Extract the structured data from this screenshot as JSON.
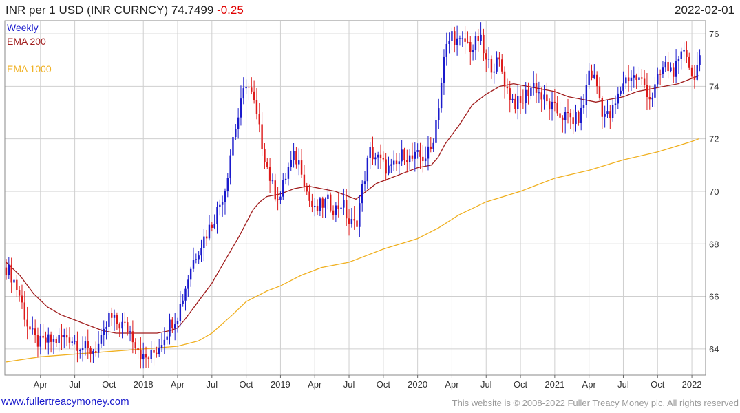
{
  "header": {
    "title": "INR per 1 USD (INR CURNCY)",
    "last": "74.7499",
    "change": "-0.25",
    "date": "2022-02-01"
  },
  "footer": {
    "site": "www.fullertreacymoney.com",
    "copyright": "This website is © 2008-2022 Fuller Treacy Money plc. All rights reserved"
  },
  "colors": {
    "up_candle": "#1a1acc",
    "down_candle": "#dd1a1a",
    "ema200": "#a01c1c",
    "ema1000": "#f0b020",
    "grid": "#cfcfcf",
    "frame": "#8a8a8a"
  },
  "chart_data": {
    "type": "candlestick",
    "period_label": "Weekly",
    "legend": [
      "Weekly",
      "EMA 200",
      "EMA 1000"
    ],
    "ylim": [
      63,
      76.5
    ],
    "y_ticks": [
      64,
      66,
      68,
      70,
      72,
      74,
      76
    ],
    "x_ticks": [
      {
        "t": 2017.25,
        "label": "Apr"
      },
      {
        "t": 2017.5,
        "label": "Jul"
      },
      {
        "t": 2017.75,
        "label": "Oct"
      },
      {
        "t": 2018.0,
        "label": "2018"
      },
      {
        "t": 2018.25,
        "label": "Apr"
      },
      {
        "t": 2018.5,
        "label": "Jul"
      },
      {
        "t": 2018.75,
        "label": "Oct"
      },
      {
        "t": 2019.0,
        "label": "2019"
      },
      {
        "t": 2019.25,
        "label": "Apr"
      },
      {
        "t": 2019.5,
        "label": "Jul"
      },
      {
        "t": 2019.75,
        "label": "Oct"
      },
      {
        "t": 2020.0,
        "label": "2020"
      },
      {
        "t": 2020.25,
        "label": "Apr"
      },
      {
        "t": 2020.5,
        "label": "Jul"
      },
      {
        "t": 2020.75,
        "label": "Oct"
      },
      {
        "t": 2021.0,
        "label": "2021"
      },
      {
        "t": 2021.25,
        "label": "Apr"
      },
      {
        "t": 2021.5,
        "label": "Jul"
      },
      {
        "t": 2021.75,
        "label": "Oct"
      },
      {
        "t": 2022.0,
        "label": "2022"
      }
    ],
    "x_range": [
      2016.99,
      2022.1
    ],
    "closes": [
      [
        2017.0,
        67.1
      ],
      [
        2017.05,
        66.7
      ],
      [
        2017.1,
        66.0
      ],
      [
        2017.15,
        65.0
      ],
      [
        2017.2,
        64.4
      ],
      [
        2017.25,
        64.2
      ],
      [
        2017.3,
        64.3
      ],
      [
        2017.35,
        64.3
      ],
      [
        2017.4,
        64.4
      ],
      [
        2017.45,
        64.5
      ],
      [
        2017.5,
        64.3
      ],
      [
        2017.55,
        64.1
      ],
      [
        2017.6,
        63.9
      ],
      [
        2017.65,
        64.0
      ],
      [
        2017.7,
        64.3
      ],
      [
        2017.75,
        65.2
      ],
      [
        2017.8,
        65.0
      ],
      [
        2017.85,
        64.9
      ],
      [
        2017.9,
        64.7
      ],
      [
        2017.95,
        64.2
      ],
      [
        2018.0,
        63.6
      ],
      [
        2018.05,
        63.7
      ],
      [
        2018.1,
        64.0
      ],
      [
        2018.15,
        64.5
      ],
      [
        2018.2,
        65.0
      ],
      [
        2018.25,
        65.3
      ],
      [
        2018.3,
        66.2
      ],
      [
        2018.35,
        67.2
      ],
      [
        2018.4,
        67.8
      ],
      [
        2018.45,
        68.3
      ],
      [
        2018.5,
        68.8
      ],
      [
        2018.55,
        69.4
      ],
      [
        2018.6,
        70.2
      ],
      [
        2018.65,
        72.0
      ],
      [
        2018.7,
        73.0
      ],
      [
        2018.75,
        74.2
      ],
      [
        2018.8,
        73.5
      ],
      [
        2018.85,
        72.2
      ],
      [
        2018.9,
        71.0
      ],
      [
        2018.95,
        70.0
      ],
      [
        2019.0,
        69.8
      ],
      [
        2019.05,
        70.8
      ],
      [
        2019.1,
        71.3
      ],
      [
        2019.15,
        71.0
      ],
      [
        2019.2,
        69.8
      ],
      [
        2019.25,
        69.2
      ],
      [
        2019.3,
        69.5
      ],
      [
        2019.35,
        69.6
      ],
      [
        2019.4,
        69.3
      ],
      [
        2019.45,
        69.6
      ],
      [
        2019.5,
        68.8
      ],
      [
        2019.55,
        68.7
      ],
      [
        2019.6,
        70.2
      ],
      [
        2019.65,
        71.5
      ],
      [
        2019.7,
        71.3
      ],
      [
        2019.75,
        71.0
      ],
      [
        2019.8,
        70.8
      ],
      [
        2019.85,
        71.0
      ],
      [
        2019.9,
        71.5
      ],
      [
        2019.95,
        71.2
      ],
      [
        2020.0,
        71.3
      ],
      [
        2020.05,
        71.3
      ],
      [
        2020.1,
        71.6
      ],
      [
        2020.15,
        73.2
      ],
      [
        2020.2,
        75.3
      ],
      [
        2020.25,
        76.0
      ],
      [
        2020.3,
        75.6
      ],
      [
        2020.35,
        75.7
      ],
      [
        2020.4,
        75.4
      ],
      [
        2020.45,
        75.9
      ],
      [
        2020.5,
        74.9
      ],
      [
        2020.55,
        74.8
      ],
      [
        2020.6,
        74.9
      ],
      [
        2020.65,
        73.9
      ],
      [
        2020.7,
        73.4
      ],
      [
        2020.75,
        73.3
      ],
      [
        2020.8,
        73.8
      ],
      [
        2020.85,
        74.1
      ],
      [
        2020.9,
        73.6
      ],
      [
        2020.95,
        73.3
      ],
      [
        2021.0,
        73.1
      ],
      [
        2021.05,
        72.9
      ],
      [
        2021.1,
        72.8
      ],
      [
        2021.15,
        72.7
      ],
      [
        2021.2,
        73.0
      ],
      [
        2021.25,
        74.6
      ],
      [
        2021.3,
        74.2
      ],
      [
        2021.35,
        73.0
      ],
      [
        2021.4,
        72.8
      ],
      [
        2021.45,
        73.4
      ],
      [
        2021.5,
        74.2
      ],
      [
        2021.55,
        74.4
      ],
      [
        2021.6,
        74.3
      ],
      [
        2021.65,
        74.1
      ],
      [
        2021.7,
        73.5
      ],
      [
        2021.75,
        74.2
      ],
      [
        2021.8,
        74.8
      ],
      [
        2021.85,
        74.6
      ],
      [
        2021.9,
        74.7
      ],
      [
        2021.95,
        75.6
      ],
      [
        2022.0,
        74.3
      ],
      [
        2022.05,
        74.9
      ]
    ],
    "ema200": [
      [
        2017.0,
        67.3
      ],
      [
        2017.1,
        66.8
      ],
      [
        2017.2,
        66.1
      ],
      [
        2017.3,
        65.6
      ],
      [
        2017.4,
        65.3
      ],
      [
        2017.5,
        65.1
      ],
      [
        2017.6,
        64.9
      ],
      [
        2017.7,
        64.7
      ],
      [
        2017.8,
        64.6
      ],
      [
        2017.9,
        64.6
      ],
      [
        2018.0,
        64.6
      ],
      [
        2018.1,
        64.6
      ],
      [
        2018.2,
        64.7
      ],
      [
        2018.25,
        64.8
      ],
      [
        2018.3,
        65.1
      ],
      [
        2018.4,
        65.8
      ],
      [
        2018.5,
        66.5
      ],
      [
        2018.6,
        67.4
      ],
      [
        2018.7,
        68.3
      ],
      [
        2018.8,
        69.3
      ],
      [
        2018.85,
        69.6
      ],
      [
        2018.9,
        69.8
      ],
      [
        2019.0,
        69.9
      ],
      [
        2019.1,
        70.1
      ],
      [
        2019.2,
        70.2
      ],
      [
        2019.3,
        70.1
      ],
      [
        2019.4,
        70.0
      ],
      [
        2019.5,
        69.8
      ],
      [
        2019.55,
        69.7
      ],
      [
        2019.6,
        69.9
      ],
      [
        2019.7,
        70.3
      ],
      [
        2019.8,
        70.5
      ],
      [
        2019.9,
        70.7
      ],
      [
        2020.0,
        70.9
      ],
      [
        2020.1,
        71.0
      ],
      [
        2020.15,
        71.3
      ],
      [
        2020.2,
        71.8
      ],
      [
        2020.3,
        72.5
      ],
      [
        2020.4,
        73.3
      ],
      [
        2020.5,
        73.7
      ],
      [
        2020.6,
        74.0
      ],
      [
        2020.7,
        74.1
      ],
      [
        2020.8,
        74.0
      ],
      [
        2020.9,
        73.9
      ],
      [
        2021.0,
        73.8
      ],
      [
        2021.1,
        73.6
      ],
      [
        2021.2,
        73.5
      ],
      [
        2021.3,
        73.4
      ],
      [
        2021.4,
        73.5
      ],
      [
        2021.5,
        73.6
      ],
      [
        2021.6,
        73.8
      ],
      [
        2021.7,
        73.9
      ],
      [
        2021.8,
        74.0
      ],
      [
        2021.9,
        74.1
      ],
      [
        2022.0,
        74.3
      ],
      [
        2022.05,
        74.4
      ]
    ],
    "ema1000": [
      [
        2017.0,
        63.5
      ],
      [
        2017.25,
        63.7
      ],
      [
        2017.5,
        63.8
      ],
      [
        2017.75,
        63.9
      ],
      [
        2018.0,
        64.0
      ],
      [
        2018.25,
        64.1
      ],
      [
        2018.4,
        64.3
      ],
      [
        2018.5,
        64.6
      ],
      [
        2018.65,
        65.3
      ],
      [
        2018.75,
        65.8
      ],
      [
        2018.9,
        66.2
      ],
      [
        2019.0,
        66.4
      ],
      [
        2019.15,
        66.8
      ],
      [
        2019.3,
        67.1
      ],
      [
        2019.5,
        67.3
      ],
      [
        2019.6,
        67.5
      ],
      [
        2019.75,
        67.8
      ],
      [
        2020.0,
        68.2
      ],
      [
        2020.15,
        68.6
      ],
      [
        2020.3,
        69.1
      ],
      [
        2020.5,
        69.6
      ],
      [
        2020.75,
        70.0
      ],
      [
        2021.0,
        70.5
      ],
      [
        2021.25,
        70.8
      ],
      [
        2021.5,
        71.2
      ],
      [
        2021.75,
        71.5
      ],
      [
        2022.0,
        71.9
      ],
      [
        2022.05,
        72.0
      ]
    ]
  }
}
